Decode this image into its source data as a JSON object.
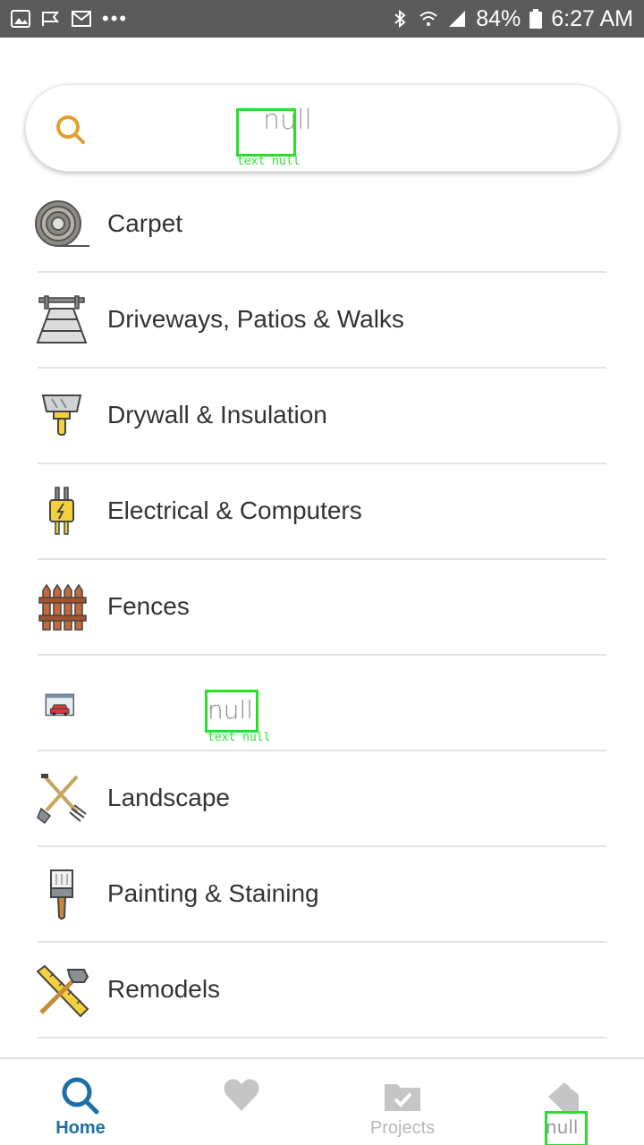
{
  "status_bar": {
    "battery": "84%",
    "time": "6:27 AM",
    "dots": "•••"
  },
  "search": {
    "value": "null",
    "debug_label": "text null"
  },
  "categories": [
    {
      "label": "Carpet",
      "icon": "carpet-roll-icon"
    },
    {
      "label": "Driveways, Patios & Walks",
      "icon": "driveway-icon"
    },
    {
      "label": "Drywall & Insulation",
      "icon": "putty-knife-icon"
    },
    {
      "label": "Electrical & Computers",
      "icon": "electrical-plug-icon"
    },
    {
      "label": "Fences",
      "icon": "fence-icon"
    },
    {
      "label": "null",
      "icon": "garage-icon",
      "debug_label": "text null"
    },
    {
      "label": "Landscape",
      "icon": "shovel-rake-icon"
    },
    {
      "label": "Painting & Staining",
      "icon": "paintbrush-icon"
    },
    {
      "label": "Remodels",
      "icon": "hammer-ruler-icon"
    }
  ],
  "bottom_nav": [
    {
      "label": "Home",
      "icon": "search-icon",
      "active": true
    },
    {
      "label": "",
      "icon": "heart-icon",
      "active": false
    },
    {
      "label": "Projects",
      "icon": "folder-check-icon",
      "active": false
    },
    {
      "label": "null",
      "icon": "tag-icon",
      "active": false
    }
  ],
  "colors": {
    "accent": "#1d6fa5",
    "search_icon": "#e0a030",
    "debug": "#2adf2a"
  }
}
